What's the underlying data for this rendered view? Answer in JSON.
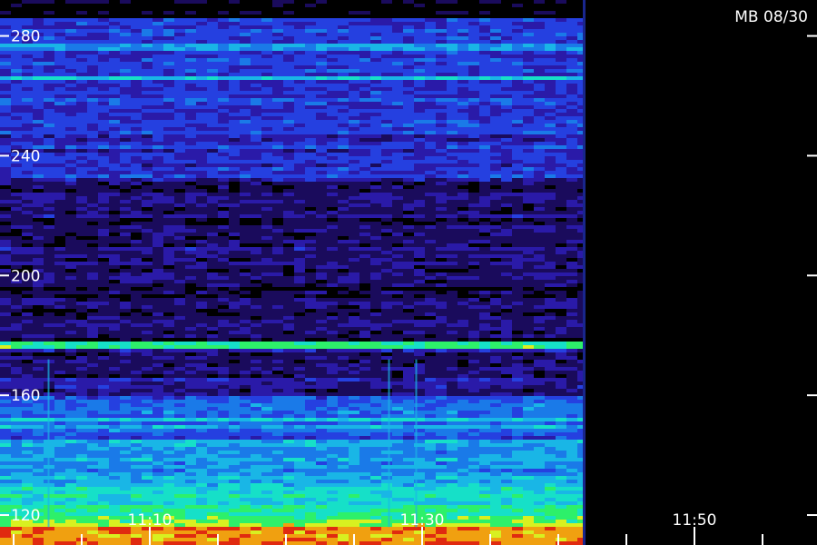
{
  "chart_data": {
    "type": "heatmap",
    "title": "MB 08/30",
    "xlabel": "",
    "ylabel": "",
    "y_ticks": [
      280,
      240,
      200,
      160,
      120
    ],
    "ylim": [
      110,
      292
    ],
    "x_ticks": [
      {
        "value": 10,
        "label": "11:10"
      },
      {
        "value": 30,
        "label": "11:30"
      },
      {
        "value": 50,
        "label": "11:50"
      }
    ],
    "xlim": [
      -1,
      59
    ],
    "data_end_x": 41.8,
    "minor_x_step": 5,
    "grid": false,
    "colormap": [
      "#000000",
      "#1a0b5c",
      "#2a1aa8",
      "#2540e0",
      "#1a7ae8",
      "#19b6e6",
      "#16e0c8",
      "#2df06a",
      "#d8f020",
      "#f0a010",
      "#e02a10"
    ],
    "bands": [
      {
        "y": 276,
        "level": 0.42
      },
      {
        "y": 266,
        "level": 0.5
      },
      {
        "y": 258,
        "level": 0.36
      },
      {
        "y": 248,
        "level": 0.3
      },
      {
        "y": 176,
        "level": 0.62
      },
      {
        "y": 152,
        "level": 0.55
      },
      {
        "y": 149,
        "level": 0.45
      }
    ],
    "vertical_streaks": [
      2.5,
      27.5,
      29.5
    ]
  }
}
